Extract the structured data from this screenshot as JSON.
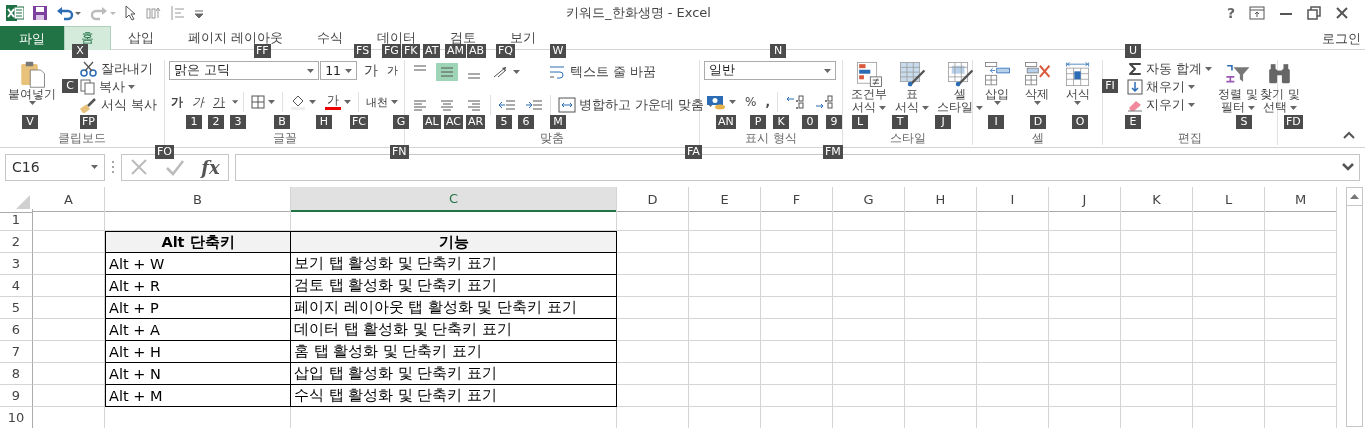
{
  "title_bar": {
    "title": "키워드_한화생명 - Excel",
    "help": "?"
  },
  "tabs": [
    {
      "label": "파일",
      "kind": "file",
      "selected": false
    },
    {
      "label": "홈",
      "kind": "tab",
      "selected": true
    },
    {
      "label": "삽입",
      "kind": "tab",
      "selected": false
    },
    {
      "label": "페이지 레이아웃",
      "kind": "tab",
      "selected": false
    },
    {
      "label": "수식",
      "kind": "tab",
      "selected": false
    },
    {
      "label": "데이터",
      "kind": "tab",
      "selected": false
    },
    {
      "label": "검토",
      "kind": "tab",
      "selected": false
    },
    {
      "label": "보기",
      "kind": "tab",
      "selected": false
    }
  ],
  "account": "로그인",
  "ribbon": {
    "clipboard": {
      "label": "클립보드",
      "paste": "붙여넣기",
      "cut": "잘라내기",
      "copy": "복사",
      "format_painter": "서식 복사"
    },
    "font": {
      "label": "글꼴",
      "font_name": "맑은 고딕",
      "font_size": "11",
      "grow": "가",
      "shrink": "가",
      "bold": "가",
      "italic": "가",
      "underline": "가",
      "font_color": "가",
      "phonetic": "내천"
    },
    "alignment": {
      "label": "맞춤",
      "vertical": [
        {
          "kind": "top",
          "selected": false
        },
        {
          "kind": "middle",
          "selected": true
        },
        {
          "kind": "bottom",
          "selected": false
        }
      ],
      "horizontal": [
        {
          "kind": "left",
          "selected": false
        },
        {
          "kind": "center",
          "selected": false
        },
        {
          "kind": "right",
          "selected": false
        }
      ],
      "wrap_text": "텍스트 줄 바꿈",
      "merge": "병합하고 가운데 맞춤"
    },
    "number": {
      "label": "표시 형식",
      "format": "일반",
      "percent": "%",
      "comma": ","
    },
    "styles": {
      "label": "스타일",
      "buttons": [
        {
          "kind": "conditional",
          "line1": "조건부",
          "line2": "서식"
        },
        {
          "kind": "table",
          "line1": "표",
          "line2": "서식"
        },
        {
          "kind": "cell",
          "line1": "셀",
          "line2": "스타일"
        }
      ]
    },
    "cells": {
      "label": "셀",
      "buttons": [
        {
          "kind": "insert",
          "label": "삽입"
        },
        {
          "kind": "delete",
          "label": "삭제"
        },
        {
          "kind": "format",
          "label": "서식"
        }
      ]
    },
    "editing": {
      "label": "편집",
      "autosum": "자동 합계",
      "fill": "채우기",
      "clear": "지우기",
      "sort": [
        "정렬 및",
        "필터"
      ],
      "find": [
        "찾기 및",
        "선택"
      ]
    }
  },
  "keytips": [
    {
      "label": "X"
    },
    {
      "label": "C"
    },
    {
      "label": "V"
    },
    {
      "label": "FP"
    },
    {
      "label": "FF"
    },
    {
      "label": "FS"
    },
    {
      "label": "FG"
    },
    {
      "label": "FK"
    },
    {
      "label": "1"
    },
    {
      "label": "2"
    },
    {
      "label": "3"
    },
    {
      "label": "B"
    },
    {
      "label": "H"
    },
    {
      "label": "FC"
    },
    {
      "label": "G"
    },
    {
      "label": "FO"
    },
    {
      "label": "FN"
    },
    {
      "label": "AT"
    },
    {
      "label": "AM"
    },
    {
      "label": "AB"
    },
    {
      "label": "FQ"
    },
    {
      "label": "W"
    },
    {
      "label": "AL"
    },
    {
      "label": "AC"
    },
    {
      "label": "AR"
    },
    {
      "label": "5"
    },
    {
      "label": "6"
    },
    {
      "label": "M"
    },
    {
      "label": "N"
    },
    {
      "label": "AN"
    },
    {
      "label": "P"
    },
    {
      "label": "K"
    },
    {
      "label": "0"
    },
    {
      "label": "9"
    },
    {
      "label": "FA"
    },
    {
      "label": "FM"
    },
    {
      "label": "L"
    },
    {
      "label": "T"
    },
    {
      "label": "J"
    },
    {
      "label": "I"
    },
    {
      "label": "D"
    },
    {
      "label": "O"
    },
    {
      "label": "U"
    },
    {
      "label": "FI"
    },
    {
      "label": "E"
    },
    {
      "label": "S"
    },
    {
      "label": "FD"
    }
  ],
  "formula_bar": {
    "name_box": "C16",
    "fx": "fx"
  },
  "sheet": {
    "columns": [
      {
        "label": "A",
        "selected": false
      },
      {
        "label": "B",
        "selected": false
      },
      {
        "label": "C",
        "selected": true
      },
      {
        "label": "D",
        "selected": false
      },
      {
        "label": "E",
        "selected": false
      },
      {
        "label": "F",
        "selected": false
      },
      {
        "label": "G",
        "selected": false
      },
      {
        "label": "H",
        "selected": false
      },
      {
        "label": "I",
        "selected": false
      },
      {
        "label": "J",
        "selected": false
      },
      {
        "label": "K",
        "selected": false
      },
      {
        "label": "L",
        "selected": false
      },
      {
        "label": "M",
        "selected": false
      }
    ],
    "rows": [
      "1",
      "2",
      "3",
      "4",
      "5",
      "6",
      "7",
      "8",
      "9",
      "10"
    ],
    "table": {
      "header": [
        "Alt 단축키",
        "기능"
      ],
      "rows": [
        [
          "Alt + W",
          "보기 탭 활성화 및 단축키 표기"
        ],
        [
          "Alt + R",
          "검토 탭 활성화 및 단축키 표기"
        ],
        [
          "Alt + P",
          "페이지 레이아웃 탭 활성화 및 단축키 표기"
        ],
        [
          "Alt + A",
          "데이터 탭 활성화 및 단축키 표기"
        ],
        [
          "Alt + H",
          "홈 탭 활성화 및 단축키 표기"
        ],
        [
          "Alt + N",
          "삽입 탭 활성화 및 단축키 표기"
        ],
        [
          "Alt + M",
          "수식 탭 활성화 및 단축키 표기"
        ]
      ]
    }
  }
}
